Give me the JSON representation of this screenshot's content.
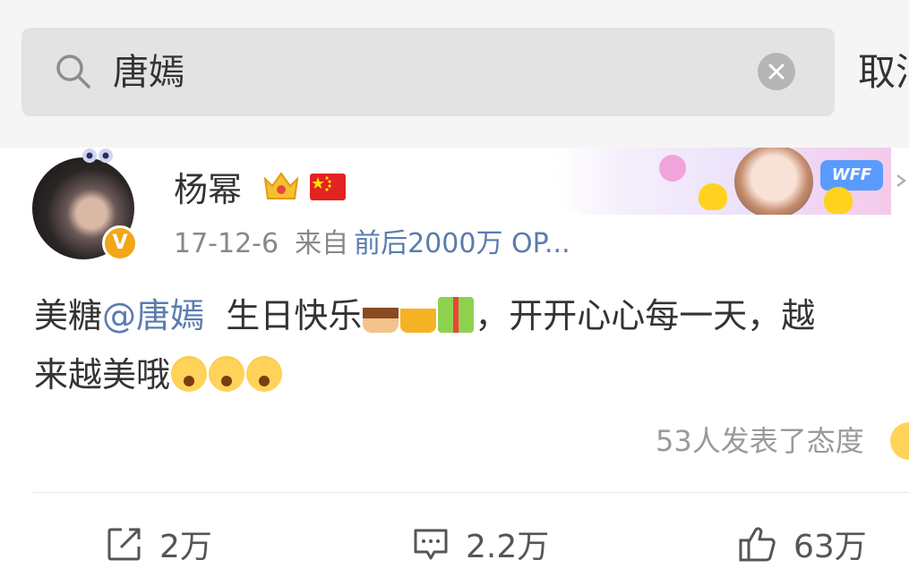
{
  "search": {
    "query": "唐嫣",
    "cancel_label": "取消"
  },
  "post": {
    "username": "杨幂",
    "date": "17-12-6",
    "from_label": "来自",
    "source": "前后2000万 OP...",
    "content_parts": {
      "prefix": "美糖",
      "mention": "@唐嫣",
      "after_mention": "  生日快乐",
      "after_emojis": "，开开心心每一天，越",
      "line2": "来越美哦"
    },
    "reactions_text": "53人发表了态度"
  },
  "actions": {
    "repost_count": "2万",
    "comment_count": "2.2万",
    "like_count": "63万"
  },
  "colors": {
    "link": "#5a7cae",
    "verified": "#f2a618",
    "flag": "#e32222"
  }
}
